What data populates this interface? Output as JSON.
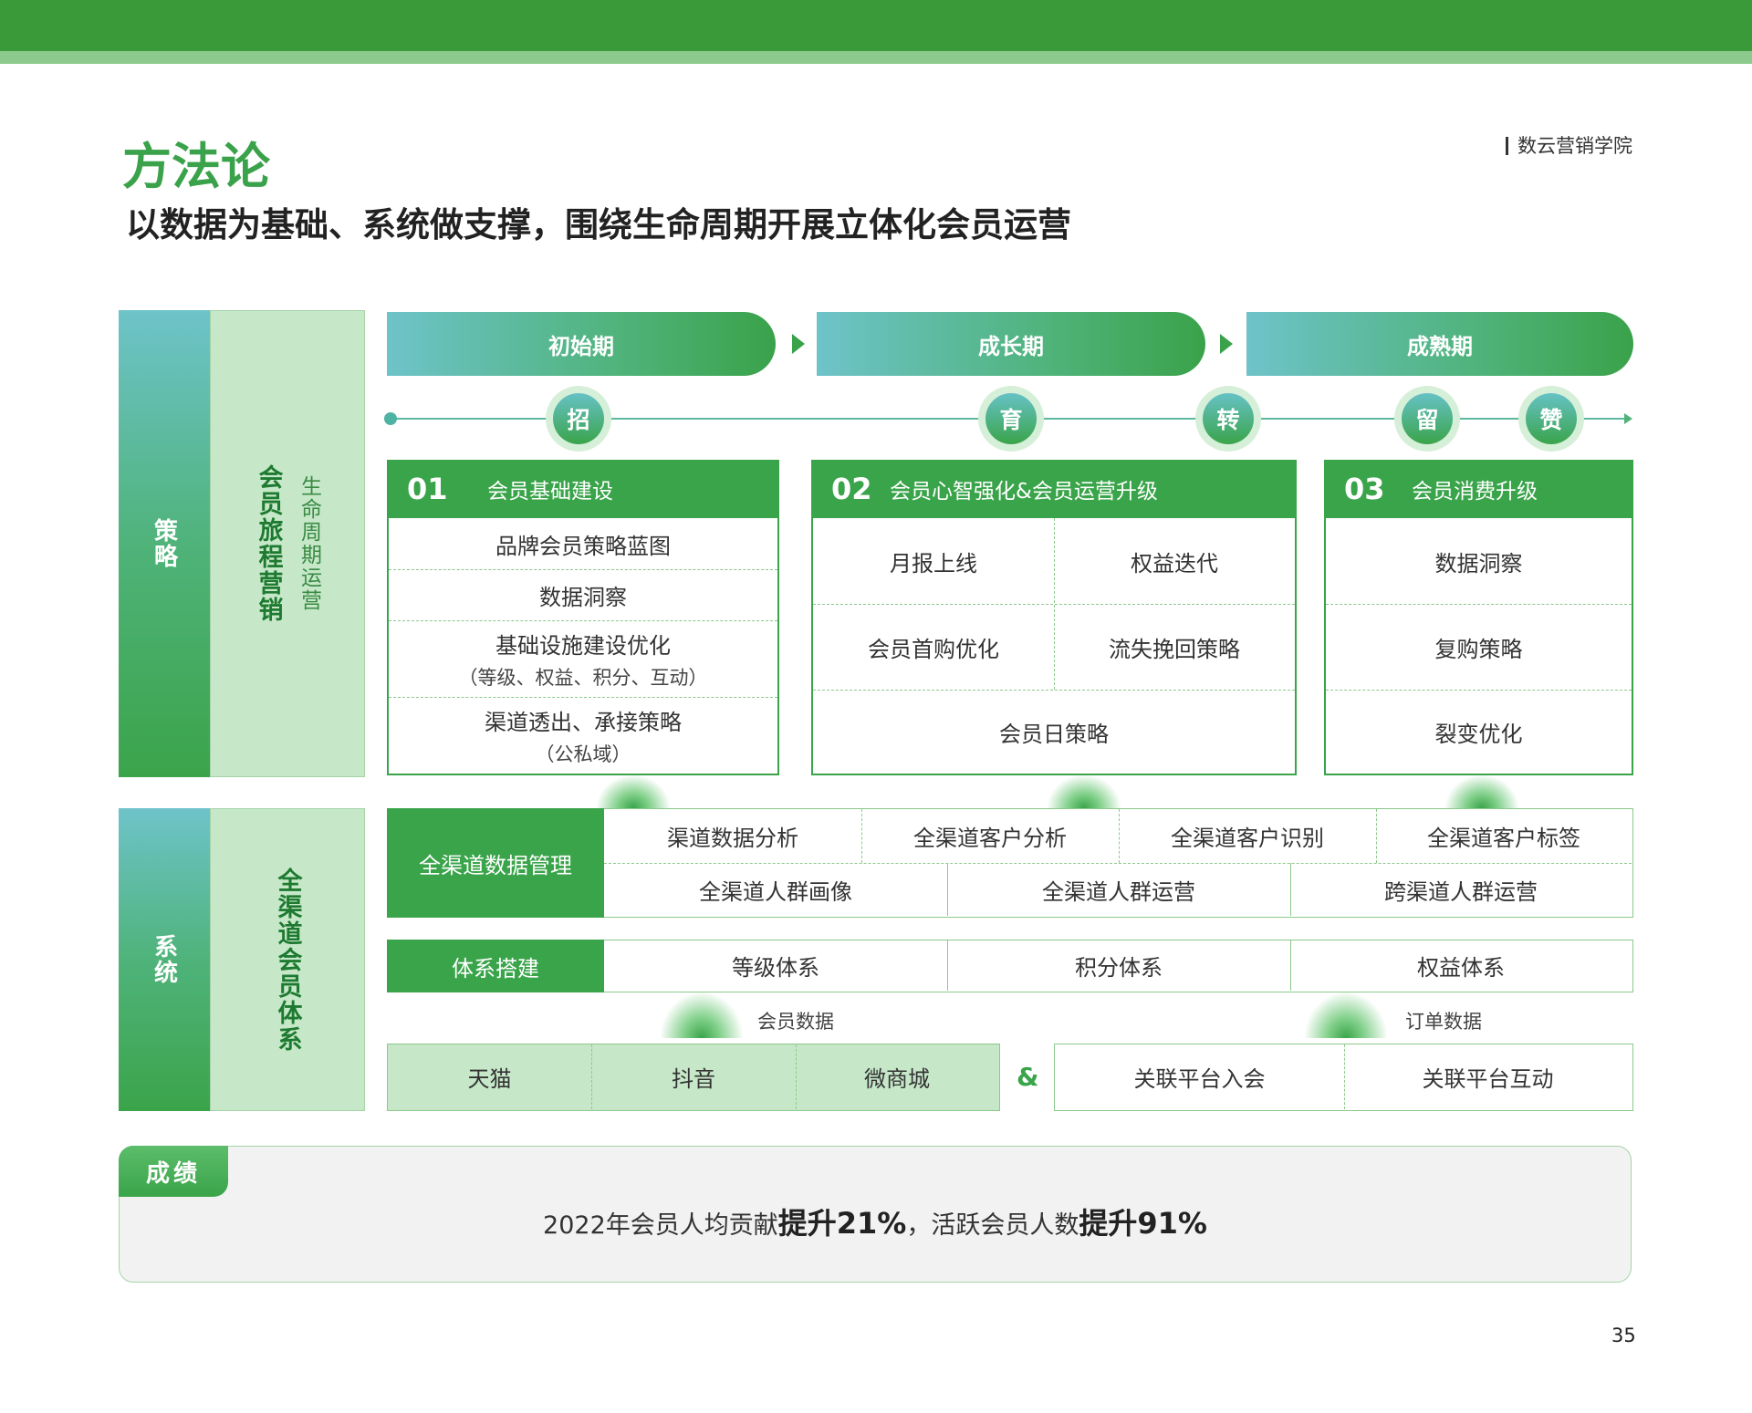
{
  "header": {
    "title": "方法论",
    "subtitle": "以数据为基础、系统做支撑，围绕生命周期开展立体化会员运营",
    "brand": "数云营销学院"
  },
  "strategy": {
    "label": "策略",
    "main": "会员旅程营销",
    "sub": "生命周期运营"
  },
  "phases": [
    "初始期",
    "成长期",
    "成熟期"
  ],
  "nodes": [
    "招",
    "育",
    "转",
    "留",
    "赞"
  ],
  "stage1": {
    "num": "01",
    "title": "会员基础建设",
    "items": [
      "品牌会员策略蓝图",
      "数据洞察",
      "基础设施建设优化",
      "（等级、权益、积分、互动）",
      "渠道透出、承接策略",
      "（公私域）"
    ]
  },
  "stage2": {
    "num": "02",
    "title": "会员心智强化&会员运营升级",
    "items": [
      "月报上线",
      "权益迭代",
      "会员首购优化",
      "流失挽回策略",
      "会员日策略"
    ]
  },
  "stage3": {
    "num": "03",
    "title": "会员消费升级",
    "items": [
      "数据洞察",
      "复购策略",
      "裂变优化"
    ]
  },
  "system": {
    "label": "系统",
    "main": "全渠道会员体系"
  },
  "data_mgmt": {
    "label": "全渠道数据管理",
    "row1": [
      "渠道数据分析",
      "全渠道客户分析",
      "全渠道客户识别",
      "全渠道客户标签"
    ],
    "row2": [
      "全渠道人群画像",
      "全渠道人群运营",
      "跨渠道人群运营"
    ]
  },
  "framework": {
    "label": "体系搭建",
    "items": [
      "等级体系",
      "积分体系",
      "权益体系"
    ]
  },
  "notes": {
    "member_data": "会员数据",
    "order_data": "订单数据"
  },
  "platforms": [
    "天猫",
    "抖音",
    "微商城"
  ],
  "amp": "&",
  "links": [
    "关联平台入会",
    "关联平台互动"
  ],
  "results": {
    "tab": "成绩",
    "t1": "2022年会员人均贡献",
    "b1": "提升21%",
    "t2": "，活跃会员人数",
    "b2": "提升91%"
  },
  "page_number": "35"
}
